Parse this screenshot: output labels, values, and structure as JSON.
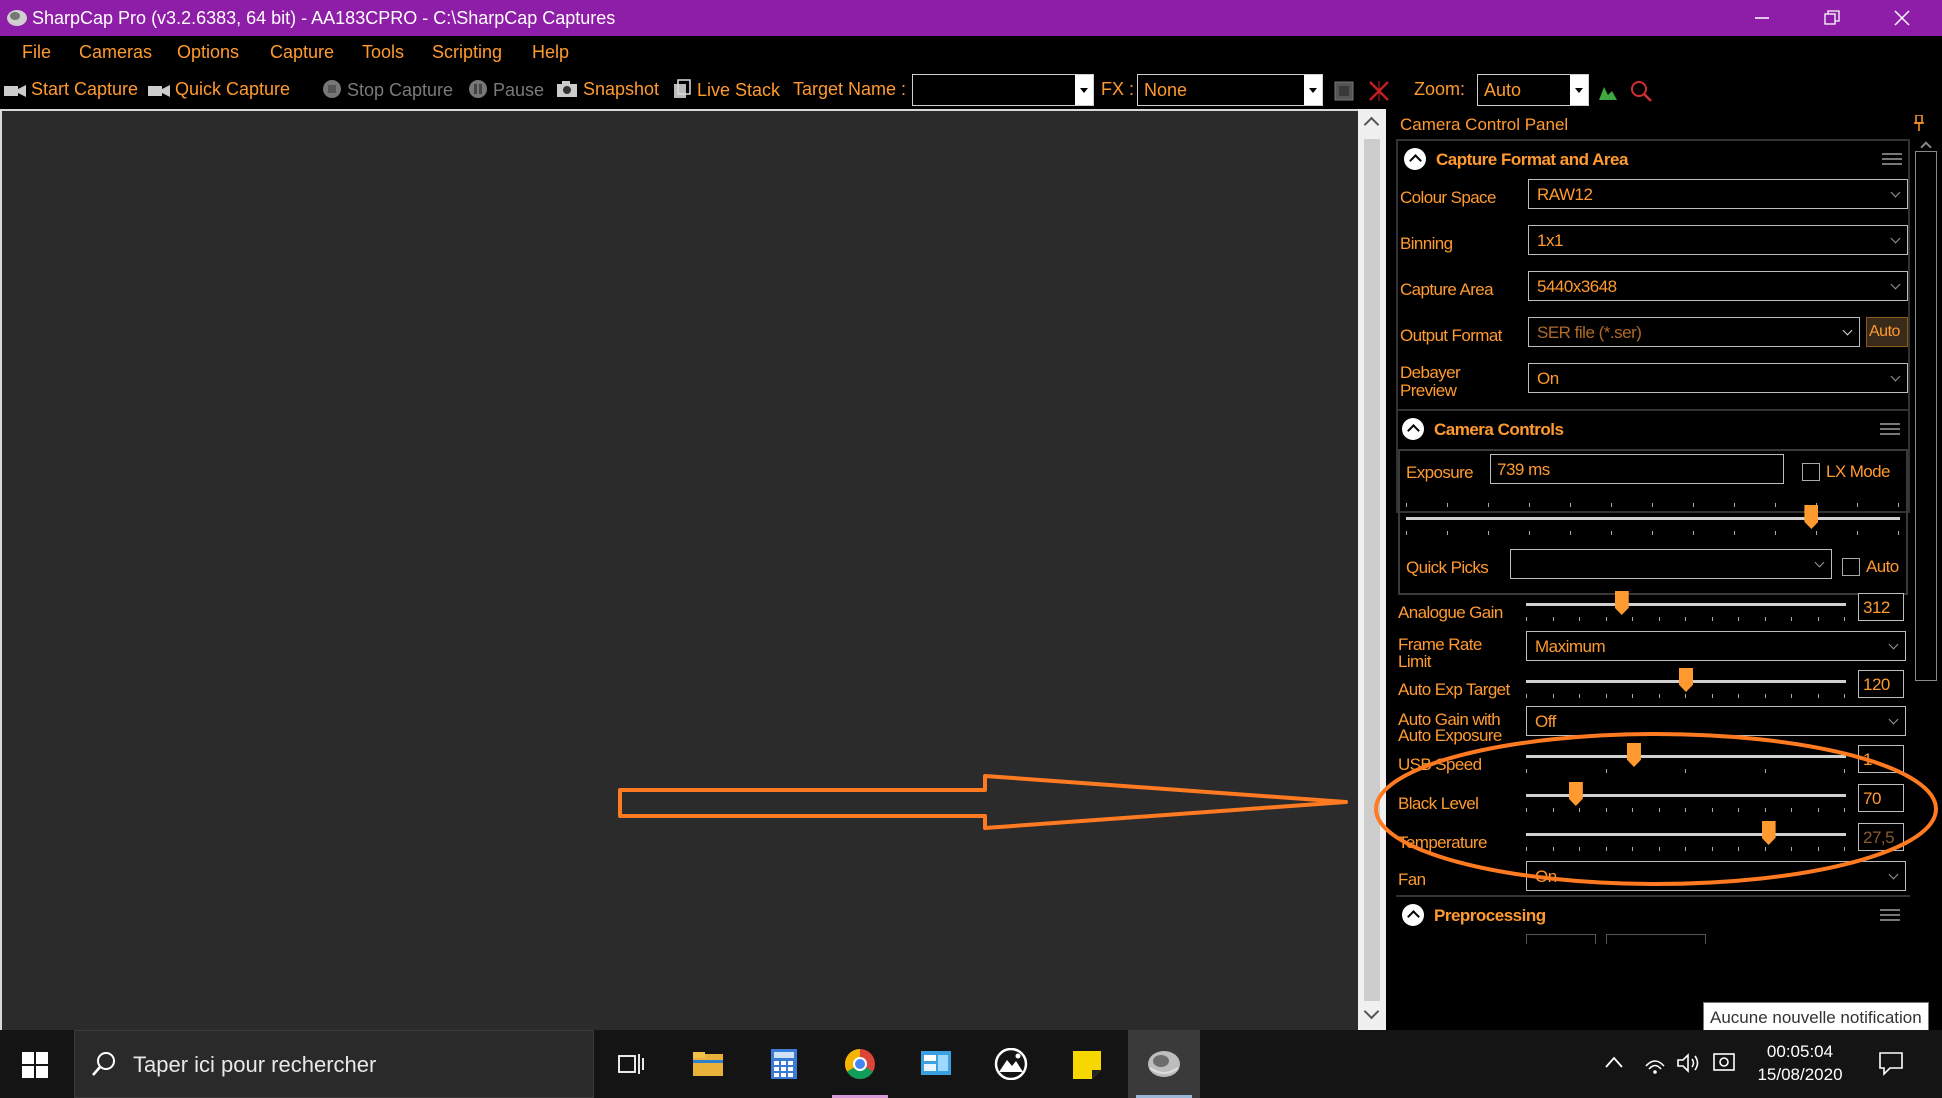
{
  "window": {
    "title": "SharpCap Pro (v3.2.6383, 64 bit) - AA183CPRO - C:\\SharpCap Captures"
  },
  "menu": [
    "File",
    "Cameras",
    "Options",
    "Capture",
    "Tools",
    "Scripting",
    "Help"
  ],
  "toolbar": {
    "start_capture": "Start Capture",
    "quick_capture": "Quick Capture",
    "stop_capture": "Stop Capture",
    "pause": "Pause",
    "snapshot": "Snapshot",
    "live_stack": "Live Stack",
    "target_name_label": "Target Name :",
    "target_name_value": "",
    "fx_label": "FX :",
    "fx_value": "None",
    "zoom_label": "Zoom:",
    "zoom_value": "Auto"
  },
  "panel": {
    "title": "Camera Control Panel",
    "capture_format": {
      "title": "Capture Format and Area",
      "colour_space_label": "Colour Space",
      "colour_space": "RAW12",
      "binning_label": "Binning",
      "binning": "1x1",
      "capture_area_label": "Capture Area",
      "capture_area": "5440x3648",
      "output_format_label": "Output Format",
      "output_format": "SER file (*.ser)",
      "output_auto": "Auto",
      "debayer_label_1": "Debayer",
      "debayer_label_2": "Preview",
      "debayer": "On"
    },
    "camera_controls": {
      "title": "Camera Controls",
      "exposure_label": "Exposure",
      "exposure": "739 ms",
      "lx_mode": "LX Mode",
      "quick_picks_label": "Quick Picks",
      "quick_picks_value": "",
      "quick_picks_auto": "Auto",
      "exposure_level": 0.83,
      "analogue_gain_label": "Analogue Gain",
      "analogue_gain": "312",
      "analogue_gain_level": 0.29,
      "frame_rate_label_1": "Frame Rate",
      "frame_rate_label_2": "Limit",
      "frame_rate": "Maximum",
      "auto_exp_target_label": "Auto Exp Target",
      "auto_exp_target": "120",
      "auto_exp_target_level": 0.5,
      "auto_gain_label_1": "Auto Gain with",
      "auto_gain_label_2": "Auto Exposure",
      "auto_gain": "Off",
      "usb_speed_label": "USB Speed",
      "usb_speed": "1",
      "usb_speed_level": 0.33,
      "black_level_label": "Black Level",
      "black_level": "70",
      "black_level_level": 0.14,
      "temperature_label": "Temperature",
      "temperature": "27,5",
      "temperature_level": 0.77,
      "fan_label": "Fan",
      "fan": "On"
    },
    "preprocessing": {
      "title": "Preprocessing"
    }
  },
  "tooltip": "Aucune nouvelle notification",
  "taskbar": {
    "search_placeholder": "Taper ici pour rechercher",
    "time": "00:05:04",
    "date": "15/08/2020"
  },
  "colors": {
    "titlebar": "#8e1da8",
    "accent": "#ff9a30",
    "annotation": "#ff7a20"
  }
}
